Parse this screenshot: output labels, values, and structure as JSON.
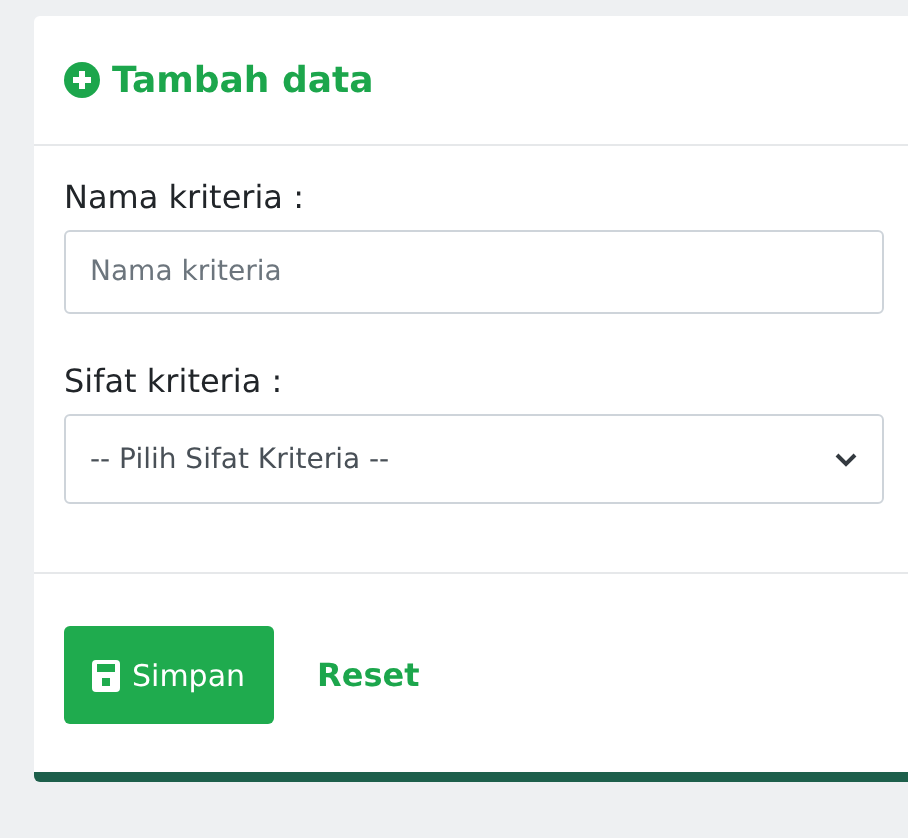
{
  "card": {
    "title": "Tambah data"
  },
  "fields": [
    {
      "kind": "text",
      "label": "Nama kriteria :",
      "placeholder": "Nama kriteria"
    },
    {
      "kind": "select",
      "label": "Sifat kriteria :",
      "value": "-- Pilih Sifat Kriteria --"
    }
  ],
  "buttons": [
    {
      "kind": "primary",
      "label": "Simpan"
    },
    {
      "kind": "link",
      "label": "Reset"
    }
  ]
}
